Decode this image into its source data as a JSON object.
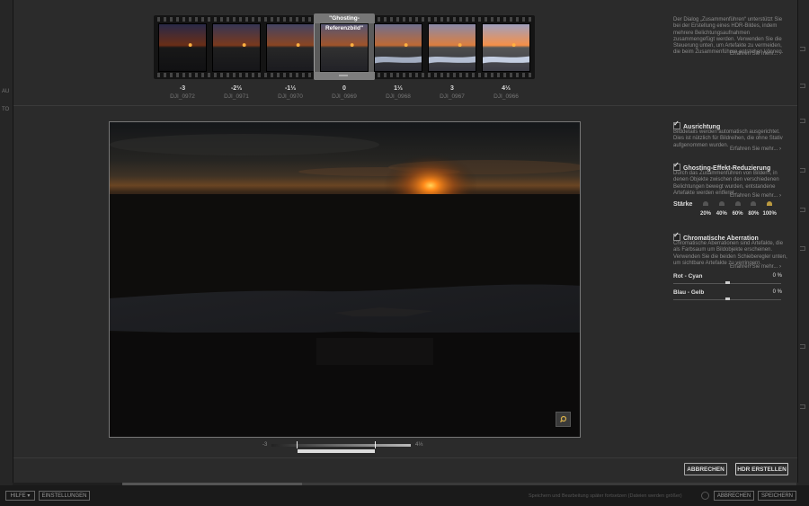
{
  "left_panel": {
    "labels": [
      "AU",
      "TO"
    ]
  },
  "filmstrip": {
    "reference_label": "\"Ghosting-Referenzbild\"",
    "selected_index": 3,
    "images": [
      {
        "ev": "-3",
        "file": "DJI_0972",
        "brightness": 0.18
      },
      {
        "ev": "-2⅔",
        "file": "DJI_0971",
        "brightness": 0.26
      },
      {
        "ev": "-1⅓",
        "file": "DJI_0970",
        "brightness": 0.34
      },
      {
        "ev": "0",
        "file": "DJI_0969",
        "brightness": 0.45
      },
      {
        "ev": "1⅓",
        "file": "DJI_0968",
        "brightness": 0.6
      },
      {
        "ev": "3",
        "file": "DJI_0967",
        "brightness": 0.75
      },
      {
        "ev": "4⅓",
        "file": "DJI_0966",
        "brightness": 0.88
      }
    ]
  },
  "intro": {
    "text": "Der Dialog „Zusammenführen“ unterstützt Sie bei der Erstellung eines HDR-Bildes, indem mehrere Belichtungsaufnahmen zusammengefügt werden. Verwenden Sie die Steuerung unten, um Artefakte zu vermeiden, die beim Zusammenführen entstehen können.",
    "more": "Erfahren Sie mehr..."
  },
  "alignment": {
    "title": "Ausrichtung",
    "checked": true,
    "text": "Bilddetails werden automatisch ausgerichtet. Dies ist nützlich für Bildreihen, die ohne Stativ aufgenommen wurden.",
    "more": "Erfahren Sie mehr..."
  },
  "ghosting": {
    "title": "Ghosting-Effekt-Reduzierung",
    "checked": true,
    "text": "Durch das Zusammenführen von Bildern, in denen Objekte zwischen den verschiedenen Belichtungen bewegt wurden, entstandene Artefakte werden entfernt.",
    "more": "Erfahren Sie mehr...",
    "strength_label": "Stärke",
    "levels": [
      "20%",
      "40%",
      "60%",
      "80%",
      "100%"
    ],
    "selected_level": 4
  },
  "chromatic": {
    "title": "Chromatische Aberration",
    "checked": true,
    "text": "Chromatische Aberrationen sind Artefakte, die als Farbsaum um Bildobjekte erscheinen. Verwenden Sie die beiden Schieberegler unten, um sichtbare Artefakte zu verringern.",
    "more": "Erfahren Sie mehr...",
    "sliders": [
      {
        "label": "Rot - Cyan",
        "value": "0 %"
      },
      {
        "label": "Blau - Gelb",
        "value": "0 %"
      }
    ]
  },
  "ev_slider": {
    "min": "-3",
    "max": "4⅓"
  },
  "buttons": {
    "cancel": "ABBRECHEN",
    "create": "HDR ERSTELLEN"
  },
  "appbar": {
    "help": "HILFE",
    "settings": "EINSTELLUNGEN",
    "hint": "Speichern und Bearbeitung später fortsetzen (Dateien werden größer)",
    "cancel": "ABBRECHEN",
    "save": "SPEICHERN"
  },
  "colors": {
    "accent": "#bb9a40",
    "bg": "#2b2b2b"
  }
}
